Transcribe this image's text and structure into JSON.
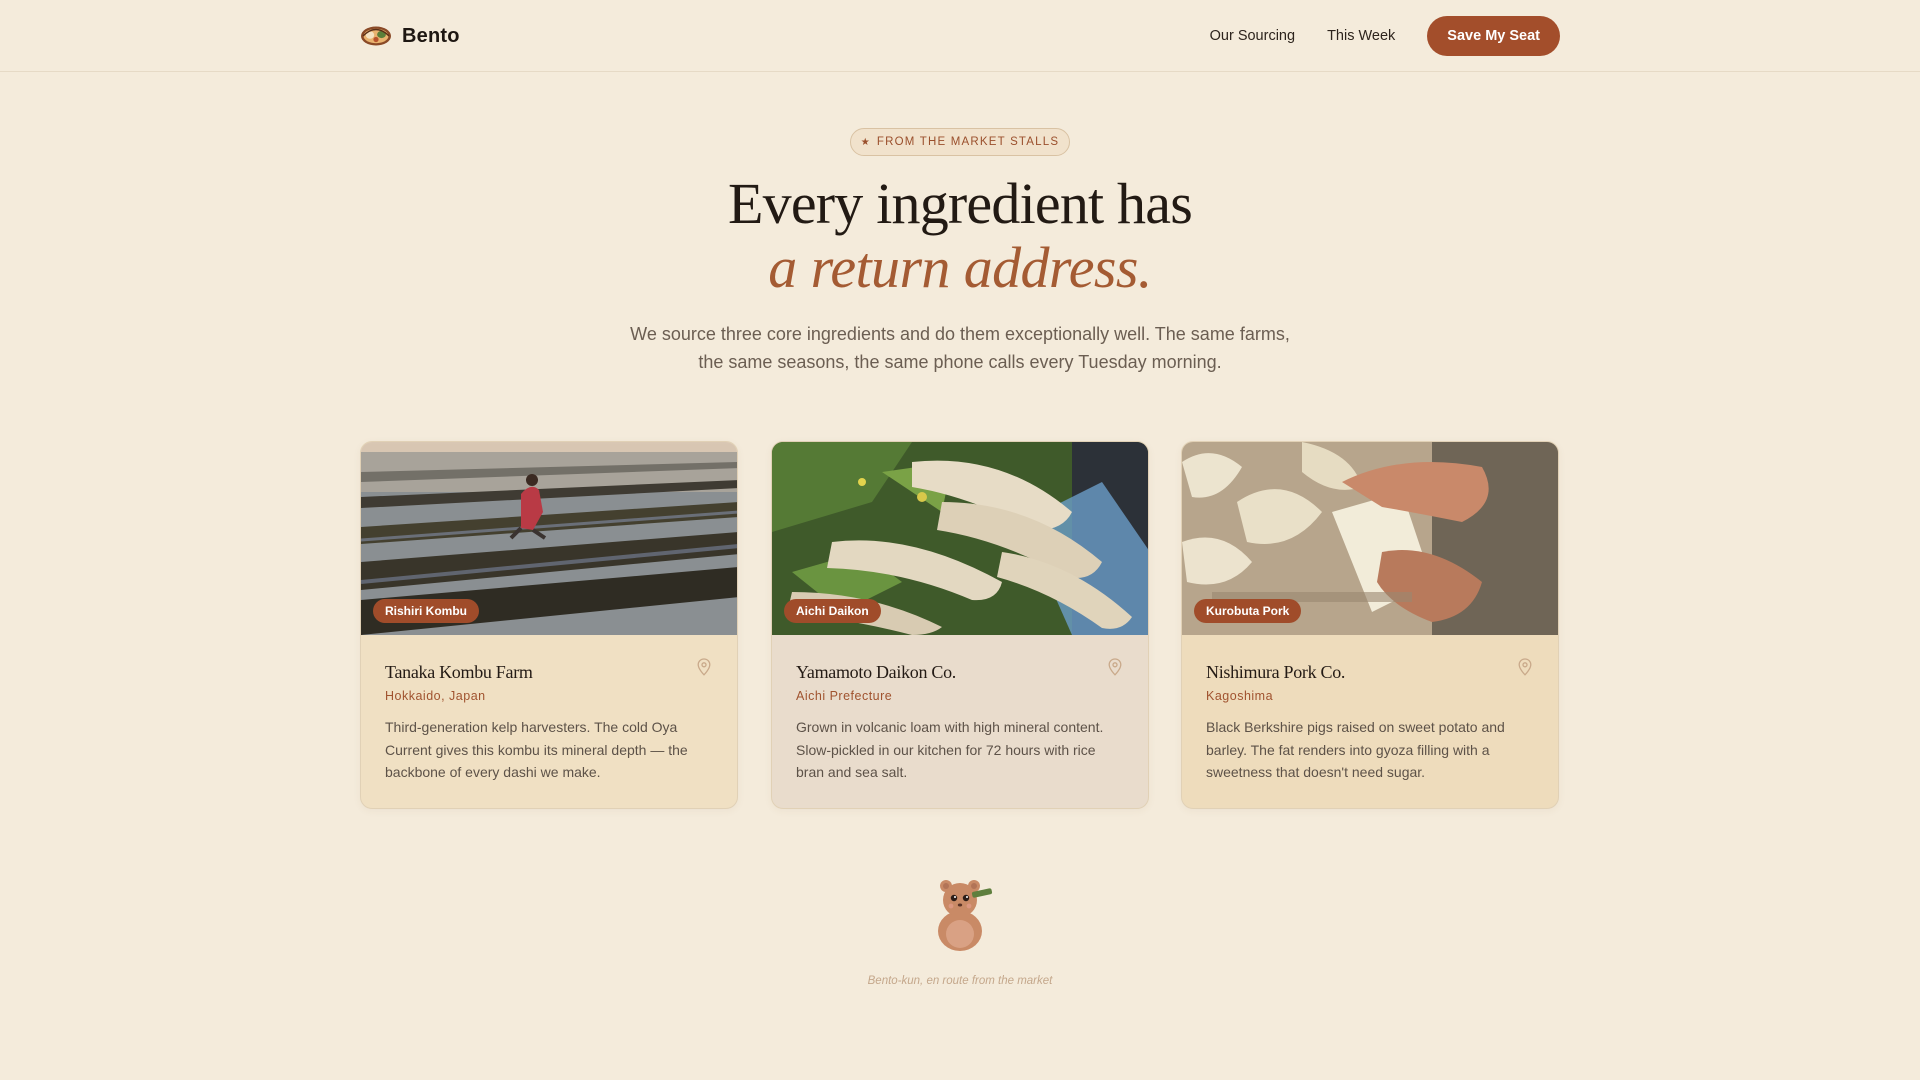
{
  "header": {
    "brand_name": "Bento",
    "brand_icon": "bento-box-icon",
    "nav": [
      "Our Sourcing",
      "This Week"
    ],
    "cta_label": "Save My Seat"
  },
  "hero": {
    "badge_icon": "star-icon",
    "badge": "FROM THE MARKET STALLS",
    "title": "Every ingredient has",
    "title_accent": "a return address.",
    "subtitle_lines": [
      "We source three core ingredients and do them exceptionally well. The same farms,",
      "the same seasons, the same phone calls every Tuesday morning."
    ]
  },
  "cards": [
    {
      "tag": "Rishiri Kombu",
      "name": "Tanaka Kombu Farm",
      "location": "Hokkaido, Japan",
      "description": "Third-generation kelp harvesters. The cold Oya Current gives this kombu its mineral depth — the backbone of every dashi we make.",
      "image": "kelp-farm-photo"
    },
    {
      "tag": "Aichi Daikon",
      "name": "Yamamoto Daikon Co.",
      "location": "Aichi Prefecture",
      "description": "Grown in volcanic loam with high mineral content. Slow-pickled in our kitchen for 72 hours with rice bran and sea salt.",
      "image": "daikon-radish-photo"
    },
    {
      "tag": "Kurobuta Pork",
      "name": "Nishimura Pork Co.",
      "location": "Kagoshima",
      "description": "Black Berkshire pigs raised on sweet potato and barley. The fat renders into gyoza filling with a sweetness that doesn't need sugar.",
      "image": "gyoza-folding-photo"
    }
  ],
  "mascot": {
    "icon": "bento-kun-mascot",
    "caption": "Bento-kun, en route from the market"
  },
  "colors": {
    "background": "#f4ebdb",
    "accent": "#a34e2b",
    "accent_text": "#a45b33",
    "heading": "#221a14",
    "muted": "#6b5e52"
  }
}
